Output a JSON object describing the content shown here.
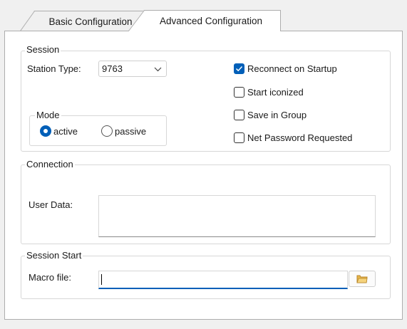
{
  "tabs": {
    "basic": "Basic Configuration",
    "advanced": "Advanced Configuration"
  },
  "session": {
    "title": "Session",
    "station_type_label": "Station Type:",
    "station_type_value": "9763",
    "mode": {
      "title": "Mode",
      "active": "active",
      "passive": "passive",
      "selected": "active"
    },
    "checkboxes": [
      {
        "label": "Reconnect on Startup",
        "checked": true
      },
      {
        "label": "Start iconized",
        "checked": false
      },
      {
        "label": "Save in Group",
        "checked": false
      },
      {
        "label": "Net Password Requested",
        "checked": false
      }
    ]
  },
  "connection": {
    "title": "Connection",
    "user_data_label": "User Data:",
    "user_data_value": ""
  },
  "session_start": {
    "title": "Session Start",
    "macro_label": "Macro file:",
    "macro_value": ""
  },
  "colors": {
    "accent": "#005fb8",
    "panel": "#ffffff",
    "background": "#f0f0f0"
  },
  "icons": {
    "dropdown": "chevron-down-icon",
    "browse": "folder-icon",
    "check": "checkmark-icon"
  }
}
